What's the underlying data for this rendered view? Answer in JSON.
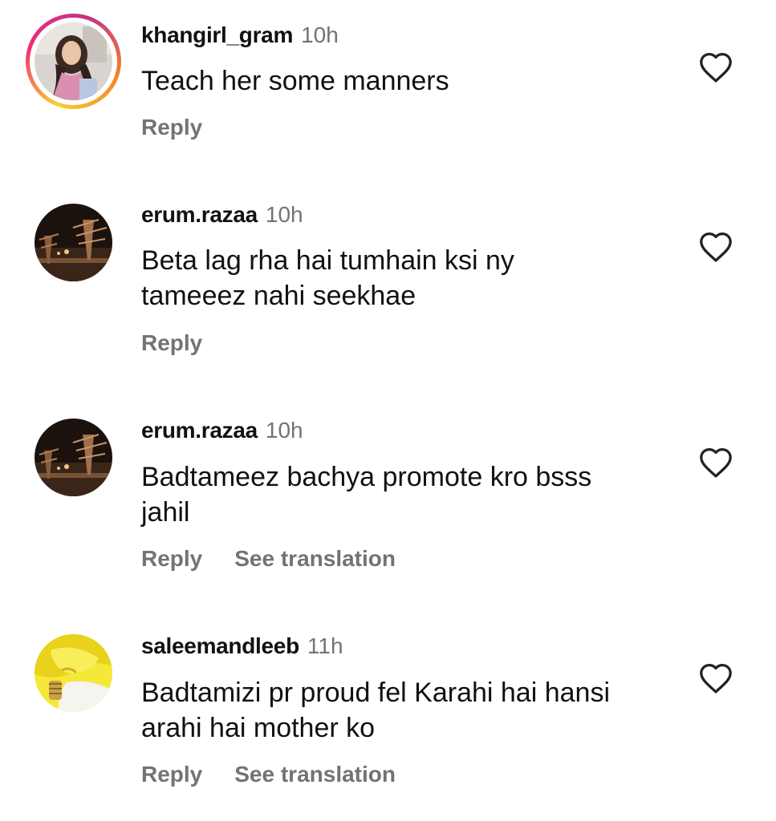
{
  "comments": [
    {
      "username": "khangirl_gram",
      "time": "10h",
      "lines": [
        "Teach her some manners"
      ],
      "reply_label": "Reply",
      "translation_label": ""
    },
    {
      "username": "erum.razaa",
      "time": "10h",
      "lines": [
        "Beta lag rha hai tumhain ksi ny",
        "tameeez nahi seekhae"
      ],
      "reply_label": "Reply",
      "translation_label": ""
    },
    {
      "username": "erum.razaa",
      "time": "10h",
      "lines": [
        "Badtameez bachya promote kro bsss",
        "jahil"
      ],
      "reply_label": "Reply",
      "translation_label": "See translation"
    },
    {
      "username": "saleemandleeb",
      "time": "11h",
      "lines": [
        "Badtamizi pr proud fel Karahi hai hansi",
        "arahi hai mother ko"
      ],
      "reply_label": "Reply",
      "translation_label": "See translation"
    }
  ],
  "icons": {
    "like": "heart-outline-icon"
  },
  "colors": {
    "text": "#111111",
    "secondary": "#737373",
    "background": "#ffffff"
  }
}
